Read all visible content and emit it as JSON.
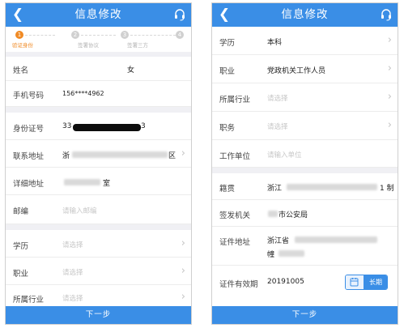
{
  "left": {
    "title": "信息修改",
    "steps": [
      {
        "num": "1",
        "label": "验证身份",
        "color": "#f08a24"
      },
      {
        "num": "2",
        "label": "签署协议",
        "color": "#d0d0d0"
      },
      {
        "num": "3",
        "label": "签署三方",
        "color": "#d0d0d0"
      },
      {
        "num": "4",
        "label": "",
        "color": "#d0d0d0"
      }
    ],
    "name_label": "姓名",
    "gender": "女",
    "phone_label": "手机号码",
    "phone_value": "156****4962",
    "id_label": "身份证号",
    "id_prefix": "33",
    "id_suffix": "3",
    "address_label": "联系地址",
    "address_start": "浙",
    "address_end": "区",
    "detail_label": "详细地址",
    "detail_end": "室",
    "postcode_label": "邮编",
    "postcode_placeholder": "请输入邮编",
    "education_label": "学历",
    "education_placeholder": "请选择",
    "job_label": "职业",
    "job_placeholder": "请选择",
    "industry_label": "所属行业",
    "industry_placeholder": "请选择",
    "next": "下一步"
  },
  "right": {
    "title": "信息修改",
    "education_label": "学历",
    "education_value": "本科",
    "job_label": "职业",
    "job_value": "党政机关工作人员",
    "industry_label": "所属行业",
    "industry_placeholder": "请选择",
    "duty_label": "职务",
    "duty_placeholder": "请选择",
    "workplace_label": "工作单位",
    "workplace_placeholder": "请输入单位",
    "native_label": "籍贯",
    "native_start": "浙江",
    "native_end": "1 制",
    "issuer_label": "签发机关",
    "issuer_value": "市公安局",
    "cert_label": "证件地址",
    "cert_start": "浙江省",
    "cert_line2_start": "幢",
    "validity_label": "证件有效期",
    "validity_value": "20191005",
    "long_term": "长期",
    "next": "下一步"
  },
  "colors": {
    "primary": "#3a8ee6",
    "active_step": "#f08a24"
  }
}
